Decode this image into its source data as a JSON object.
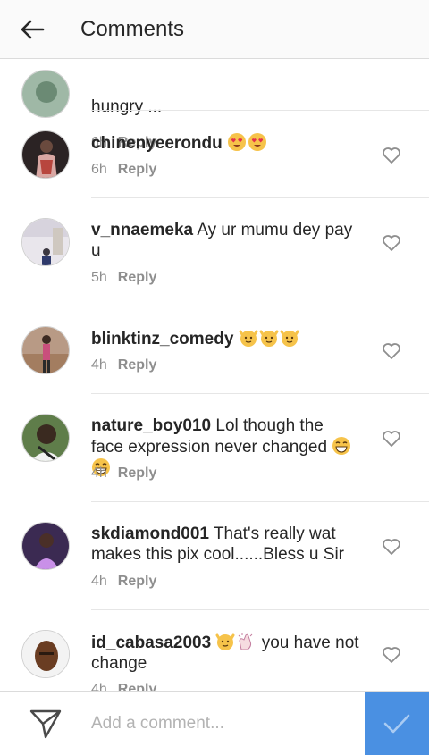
{
  "header": {
    "title": "Comments"
  },
  "comments": [
    {
      "user": "",
      "text": "hungry ...",
      "time": "6h",
      "reply": "Reply"
    },
    {
      "user": "chinenyeerondu",
      "text": "",
      "time": "6h",
      "reply": "Reply"
    },
    {
      "user": "v_nnaemeka",
      "text": "Ay ur mumu dey pay u",
      "time": "5h",
      "reply": "Reply"
    },
    {
      "user": "blinktinz_comedy",
      "text": "",
      "time": "4h",
      "reply": "Reply"
    },
    {
      "user": "nature_boy010",
      "text": "Lol though the face expression never changed",
      "time": "4h",
      "reply": "Reply"
    },
    {
      "user": "skdiamond001",
      "text": "That's really wat makes this pix cool......Bless u Sir",
      "time": "4h",
      "reply": "Reply"
    },
    {
      "user": "id_cabasa2003",
      "text": "you have not change",
      "time": "4h",
      "reply": "Reply"
    }
  ],
  "footer": {
    "placeholder": "Add a comment..."
  },
  "colors": {
    "accent": "#4a90e2",
    "muted": "#8e8e8e",
    "text": "#262626"
  },
  "icons": [
    "back-arrow-icon",
    "heart-icon",
    "send-icon",
    "check-icon",
    "heart-eyes-emoji",
    "raised-hands-emoji",
    "grinning-emoji",
    "clapping-hands-emoji"
  ]
}
